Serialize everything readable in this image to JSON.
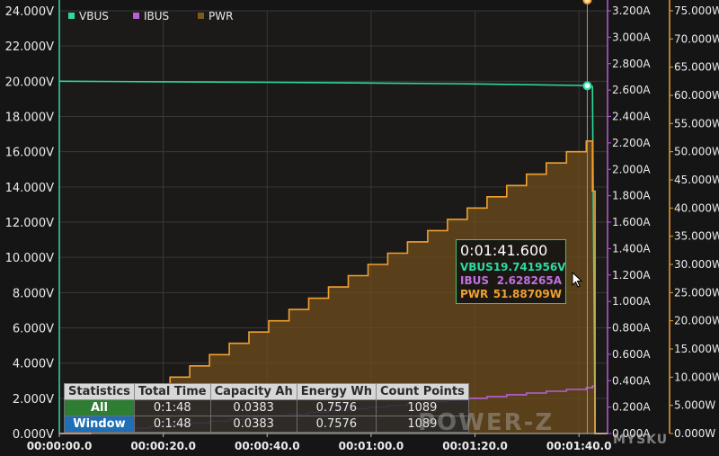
{
  "chart_data": {
    "type": "line",
    "x_unit": "seconds",
    "x_ticks": [
      "00:00:00.0",
      "00:00:20.0",
      "00:00:40.0",
      "00:01:00.0",
      "00:01:20.0",
      "00:01:40.0"
    ],
    "x_tick_values": [
      0,
      20,
      40,
      60,
      80,
      100
    ],
    "xlim": [
      0,
      105.5
    ],
    "axes": {
      "left": {
        "series": "VBUS",
        "ylim": [
          0,
          24
        ],
        "ticks": [
          "0.000V",
          "2.000V",
          "4.000V",
          "6.000V",
          "8.000V",
          "10.000V",
          "12.000V",
          "14.000V",
          "16.000V",
          "18.000V",
          "20.000V",
          "22.000V",
          "24.000V"
        ]
      },
      "right1": {
        "series": "IBUS",
        "ylim": [
          0,
          3.2
        ],
        "ticks": [
          "0.000A",
          "0.200A",
          "0.400A",
          "0.600A",
          "0.800A",
          "1.000A",
          "1.200A",
          "1.400A",
          "1.600A",
          "1.800A",
          "2.000A",
          "2.200A",
          "2.400A",
          "2.600A",
          "2.800A",
          "3.000A",
          "3.200A"
        ]
      },
      "right2": {
        "series": "PWR",
        "ylim": [
          0,
          75
        ],
        "ticks": [
          "0.000W",
          "5.000W",
          "10.000W",
          "15.000W",
          "20.000W",
          "25.000W",
          "30.000W",
          "35.000W",
          "40.000W",
          "45.000W",
          "50.000W",
          "55.000W",
          "60.000W",
          "65.000W",
          "70.000W",
          "75.000W"
        ]
      }
    },
    "legend": [
      {
        "name": "VBUS",
        "color": "#2ed9a0"
      },
      {
        "name": "IBUS",
        "color": "#b65fd6"
      },
      {
        "name": "PWR",
        "color": "#7a5a1e"
      }
    ],
    "legend_placement": "top-left",
    "grid": true,
    "series": [
      {
        "name": "VBUS",
        "axis": "left",
        "color": "#2ed9a0",
        "x": [
          0,
          20,
          40,
          60,
          80,
          100,
          101.6,
          102.6,
          103.1,
          105.5
        ],
        "values": [
          20.0,
          19.97,
          19.94,
          19.9,
          19.85,
          19.76,
          19.74,
          19.7,
          0.0,
          0.0
        ]
      },
      {
        "name": "IBUS",
        "axis": "left",
        "color": "#b65fd6",
        "step": true,
        "x": [
          0,
          6,
          9.8,
          13.6,
          17.5,
          21.3,
          25.1,
          28.9,
          32.7,
          36.5,
          40.3,
          44.2,
          48,
          51.8,
          55.6,
          59.4,
          63.2,
          67,
          70.9,
          74.7,
          78.5,
          82.3,
          86.1,
          89.9,
          93.7,
          97.6,
          101.4,
          102.6,
          103.1,
          105.5
        ],
        "values": [
          0.0,
          0.1,
          0.2,
          0.3,
          0.4,
          0.5,
          0.6,
          0.7,
          0.8,
          0.9,
          1.0,
          1.1,
          1.2,
          1.3,
          1.4,
          1.5,
          1.6,
          1.7,
          1.8,
          1.9,
          2.0,
          2.1,
          2.2,
          2.3,
          2.4,
          2.5,
          2.6,
          2.7,
          0.0,
          0.0
        ]
      },
      {
        "name": "PWR",
        "axis": "right2",
        "color": "#f0a030",
        "fill": "#6e4e1c",
        "step": true,
        "x": [
          0,
          6,
          9.8,
          13.6,
          17.5,
          21.3,
          25.1,
          28.9,
          32.7,
          36.5,
          40.3,
          44.2,
          48,
          51.8,
          55.6,
          59.4,
          63.2,
          67,
          70.9,
          74.7,
          78.5,
          82.3,
          86.1,
          89.9,
          93.7,
          97.6,
          101.4,
          102.6,
          103.1,
          105.5
        ],
        "values": [
          0.0,
          2.0,
          4.0,
          6.0,
          8.0,
          10.0,
          12.0,
          14.0,
          16.0,
          18.0,
          20.0,
          22.0,
          24.0,
          26.0,
          28.0,
          30.0,
          32.0,
          34.0,
          36.0,
          38.0,
          40.0,
          42.0,
          44.0,
          46.0,
          48.0,
          50.0,
          51.89,
          43.0,
          0.0,
          0.0
        ]
      }
    ],
    "cursor_x": 101.6,
    "tooltip": {
      "time": "0:01:41.600",
      "rows": [
        {
          "label": "VBUS",
          "value": "19.741956V",
          "color": "#2ed9a0"
        },
        {
          "label": "IBUS",
          "value": "2.628265A",
          "color": "#c070e0"
        },
        {
          "label": "PWR",
          "value": "51.88709W",
          "color": "#f0a030"
        }
      ]
    }
  },
  "stats": {
    "headers": [
      "Statistics",
      "Total Time",
      "Capacity Ah",
      "Energy Wh",
      "Count Points"
    ],
    "rows": [
      {
        "label": "All",
        "cells": [
          "0:1:48",
          "0.0383",
          "0.7576",
          "1089"
        ]
      },
      {
        "label": "Window",
        "cells": [
          "0:1:48",
          "0.0383",
          "0.7576",
          "1089"
        ]
      }
    ]
  },
  "logo_text": "POWER-Z",
  "watermark_text": "MYSKU"
}
